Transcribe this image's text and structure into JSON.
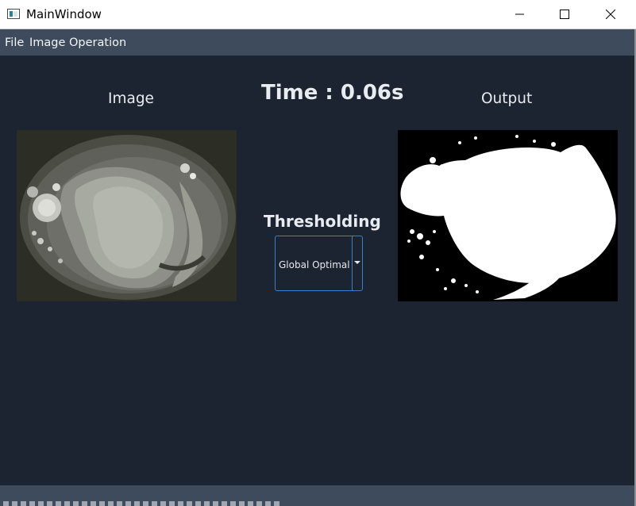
{
  "window": {
    "title": "MainWindow",
    "minimize_icon": "minimize-icon",
    "maximize_icon": "maximize-icon",
    "close_icon": "close-icon"
  },
  "menubar": {
    "items": [
      {
        "label": "File"
      },
      {
        "label": "Image Operation"
      }
    ]
  },
  "main": {
    "image_label": "Image",
    "output_label": "Output",
    "time_label": "Time : 0.06s",
    "thresholding_label": "Thresholding",
    "thresholding_combo": {
      "selected": "Global Optimal"
    }
  },
  "colors": {
    "background": "#1b2430",
    "menubar": "#3e4b5c",
    "accent_border": "#3d7fc4"
  }
}
